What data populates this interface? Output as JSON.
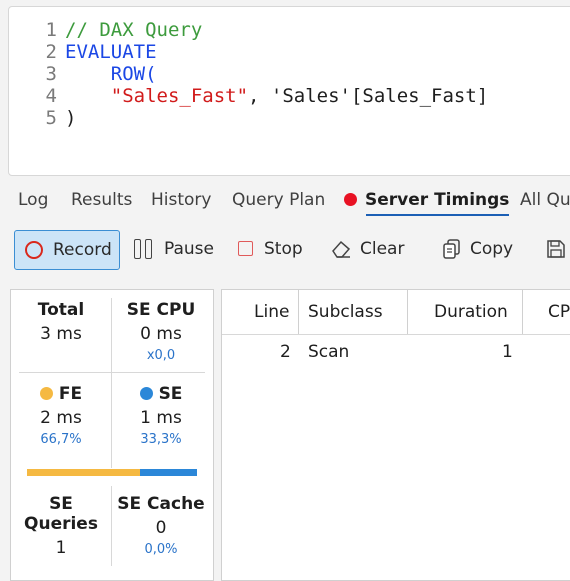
{
  "editor": {
    "lines": [
      {
        "num": "1",
        "parts": [
          {
            "t": "// DAX Query",
            "c": "comment"
          }
        ]
      },
      {
        "num": "2",
        "parts": [
          {
            "t": "EVALUATE",
            "c": "kw"
          }
        ]
      },
      {
        "num": "3",
        "parts": [
          {
            "t": "    ROW(",
            "c": "kw"
          }
        ]
      },
      {
        "num": "4",
        "parts": [
          {
            "t": "    \"Sales_Fast\"",
            "c": "str"
          },
          {
            "t": ", 'Sales'[Sales_Fast]",
            "c": "plain"
          }
        ]
      },
      {
        "num": "5",
        "parts": [
          {
            "t": ")",
            "c": "plain"
          }
        ]
      }
    ]
  },
  "tabs": {
    "log": "Log",
    "results": "Results",
    "history": "History",
    "query_plan": "Query Plan",
    "server_timings": "Server Timings",
    "all_queries": "All Qu"
  },
  "toolbar": {
    "record": "Record",
    "pause": "Pause",
    "stop": "Stop",
    "clear": "Clear",
    "copy": "Copy"
  },
  "stats": {
    "total": {
      "title": "Total",
      "value": "3 ms"
    },
    "se_cpu": {
      "title": "SE CPU",
      "value": "0 ms",
      "sub": "x0,0"
    },
    "fe": {
      "title": "FE",
      "value": "2 ms",
      "sub": "66,7%",
      "fraction": 0.667,
      "color": "#f5b942"
    },
    "se": {
      "title": "SE",
      "value": "1 ms",
      "sub": "33,3%",
      "fraction": 0.333,
      "color": "#2b87d8"
    },
    "se_queries": {
      "title": "SE Queries",
      "value": "1"
    },
    "se_cache": {
      "title": "SE Cache",
      "value": "0",
      "sub": "0,0%"
    }
  },
  "grid": {
    "headers": {
      "line": "Line",
      "subclass": "Subclass",
      "duration": "Duration",
      "cpu": "CP"
    },
    "rows": [
      {
        "line": "2",
        "subclass": "Scan",
        "duration": "1"
      }
    ]
  },
  "colors": {
    "accent": "#1b5fb5",
    "record_dot": "#e81123",
    "fe": "#f5b942",
    "se": "#2b87d8"
  }
}
